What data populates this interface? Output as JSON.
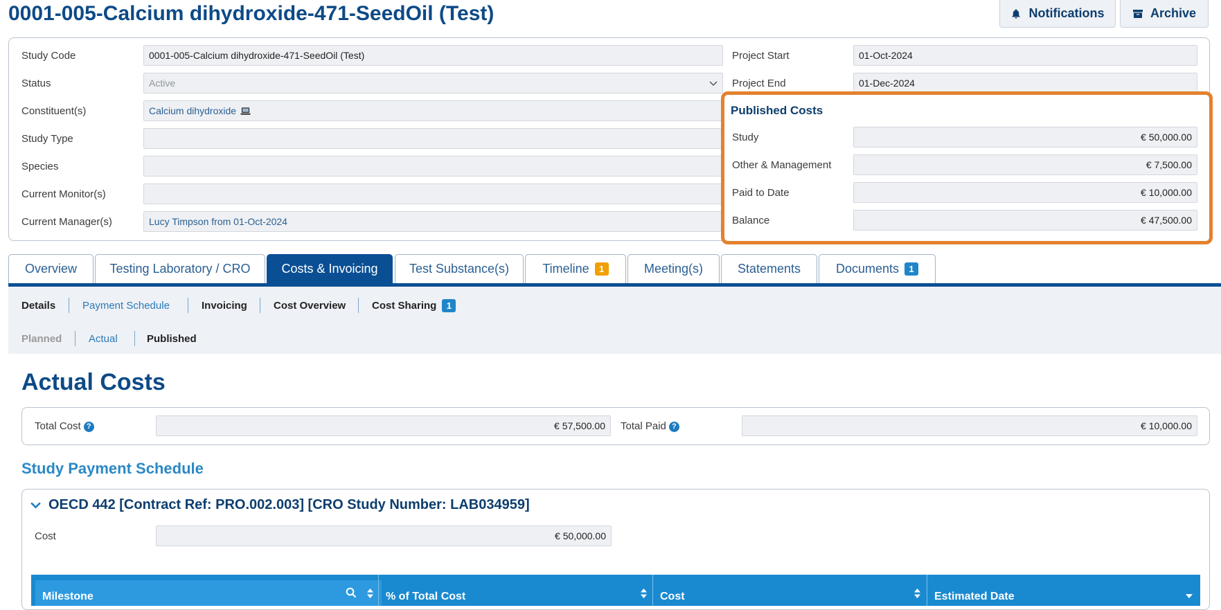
{
  "header": {
    "title": "0001-005-Calcium dihydroxide-471-SeedOil (Test)",
    "notifications_label": "Notifications",
    "archive_label": "Archive"
  },
  "details": {
    "study_code_label": "Study Code",
    "study_code": "0001-005-Calcium dihydroxide-471-SeedOil (Test)",
    "status_label": "Status",
    "status": "Active",
    "constituents_label": "Constituent(s)",
    "constituents": "Calcium dihydroxide",
    "study_type_label": "Study Type",
    "study_type": "",
    "species_label": "Species",
    "species": "",
    "monitors_label": "Current Monitor(s)",
    "monitors": "",
    "managers_label": "Current Manager(s)",
    "managers": "Lucy Timpson from 01-Oct-2024",
    "project_start_label": "Project Start",
    "project_start": "01-Oct-2024",
    "project_end_label": "Project End",
    "project_end": "01-Dec-2024"
  },
  "published_costs": {
    "title": "Published Costs",
    "study_label": "Study",
    "study": "€ 50,000.00",
    "other_label": "Other & Management",
    "other": "€ 7,500.00",
    "paid_label": "Paid to Date",
    "paid": "€ 10,000.00",
    "balance_label": "Balance",
    "balance": "€ 47,500.00",
    "highlight_color": "#e4812f"
  },
  "tabs": [
    {
      "label": "Overview"
    },
    {
      "label": "Testing Laboratory / CRO"
    },
    {
      "label": "Costs & Invoicing"
    },
    {
      "label": "Test Substance(s)"
    },
    {
      "label": "Timeline",
      "badge": "1"
    },
    {
      "label": "Meeting(s)"
    },
    {
      "label": "Statements"
    },
    {
      "label": "Documents",
      "badge": "1"
    }
  ],
  "subtabs": [
    {
      "label": "Details"
    },
    {
      "label": "Payment Schedule"
    },
    {
      "label": "Invoicing"
    },
    {
      "label": "Cost Overview"
    },
    {
      "label": "Cost Sharing",
      "badge": "1"
    }
  ],
  "cost_tabs": [
    {
      "label": "Planned"
    },
    {
      "label": "Actual"
    },
    {
      "label": "Published"
    }
  ],
  "actual": {
    "heading": "Actual Costs",
    "total_cost_label": "Total Cost",
    "total_cost": "€ 57,500.00",
    "total_paid_label": "Total Paid",
    "total_paid": "€ 10,000.00",
    "help_glyph": "?"
  },
  "schedule": {
    "heading": "Study Payment Schedule",
    "item_title": "OECD 442 [Contract Ref: PRO.002.003] [CRO Study Number: LAB034959]",
    "cost_label": "Cost",
    "cost": "€ 50,000.00",
    "columns": [
      "Milestone",
      "% of Total Cost",
      "Cost",
      "Estimated Date"
    ]
  },
  "colors": {
    "primary": "#0a4f94",
    "title": "#0d4a86",
    "grid_header": "#1a8ad0",
    "badge_orange": "#f0a000",
    "badge_blue": "#1f86c9"
  }
}
